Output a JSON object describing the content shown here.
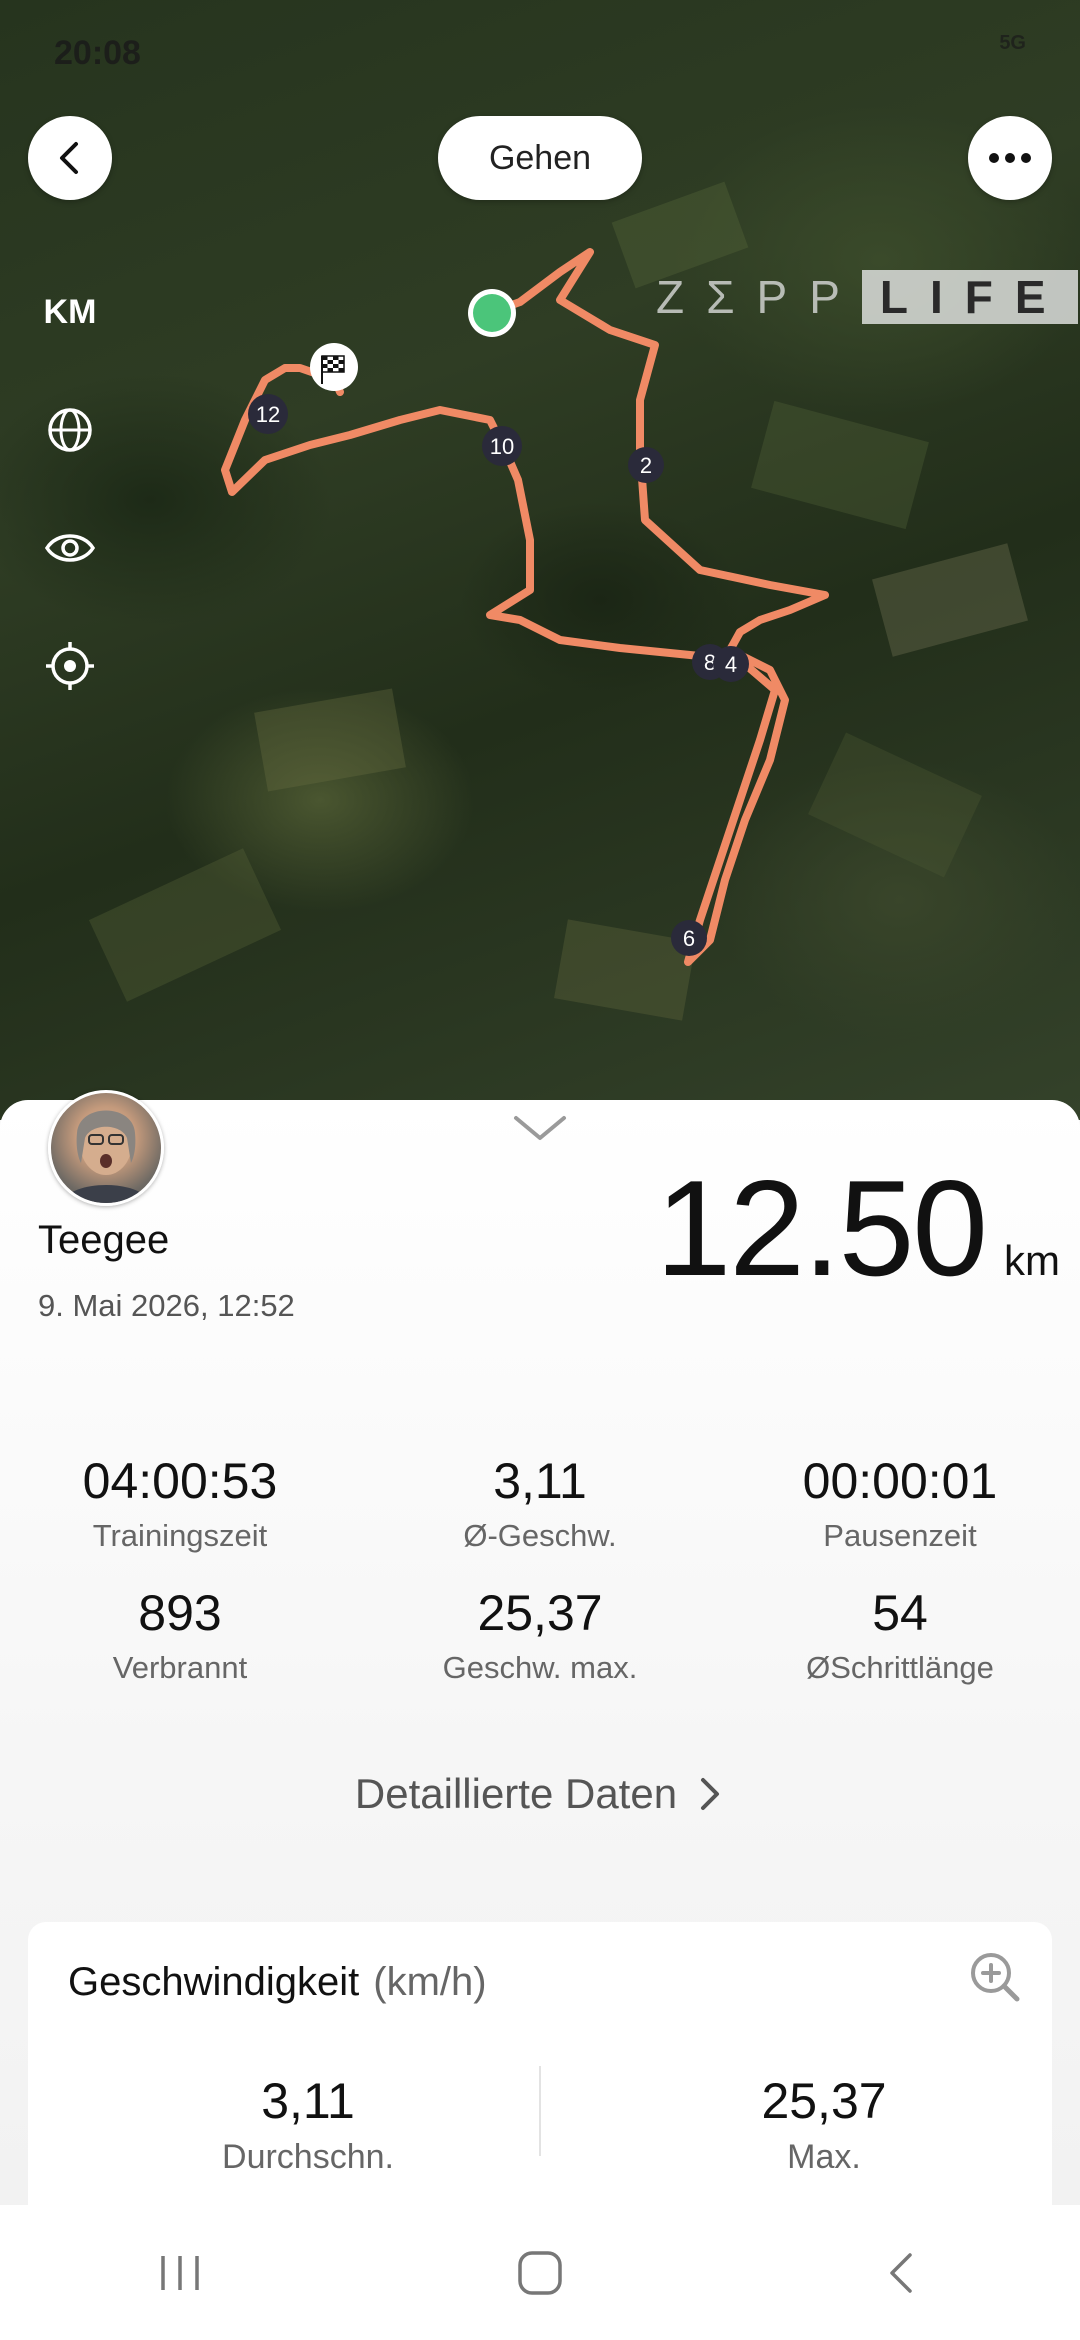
{
  "status_bar": {
    "time": "20:08",
    "network": "5G"
  },
  "map": {
    "activity_type": "Gehen",
    "watermark_left": "ZΣPP",
    "watermark_right": "LIFE",
    "unit_toggle": "KM",
    "route_color": "#f08a65",
    "km_markers": [
      "2",
      "4",
      "6",
      "8",
      "10",
      "12"
    ],
    "controls": [
      "back-icon",
      "more-icon",
      "globe-icon",
      "eye-icon",
      "locate-icon"
    ]
  },
  "summary": {
    "user_name": "Teegee",
    "date": "9. Mai 2026, 12:52",
    "distance_value": "12.50",
    "distance_unit": "km"
  },
  "stats": [
    {
      "value": "04:00:53",
      "label": "Trainingszeit"
    },
    {
      "value": "3,11",
      "label": "Ø-Geschw."
    },
    {
      "value": "00:00:01",
      "label": "Pausenzeit"
    },
    {
      "value": "893",
      "label": "Verbrannt"
    },
    {
      "value": "25,37",
      "label": "Geschw. max."
    },
    {
      "value": "54",
      "label": "ØSchrittlänge"
    }
  ],
  "detail_link": "Detaillierte Daten",
  "speed_card": {
    "title": "Geschwindigkeit",
    "unit": "(km/h)",
    "avg_value": "3,11",
    "avg_label": "Durchschn.",
    "max_value": "25,37",
    "max_label": "Max."
  }
}
